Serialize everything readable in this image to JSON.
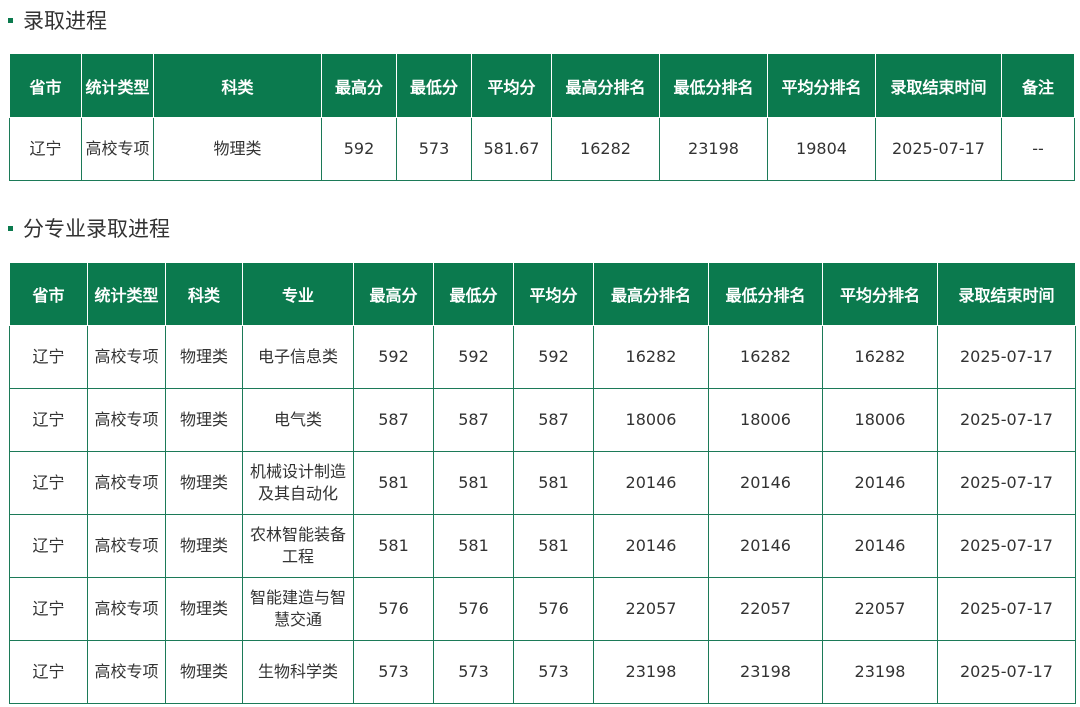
{
  "section1": {
    "title": "录取进程",
    "headers": [
      "省市",
      "统计类型",
      "科类",
      "最高分",
      "最低分",
      "平均分",
      "最高分排名",
      "最低分排名",
      "平均分排名",
      "录取结束时间",
      "备注"
    ],
    "rows": [
      [
        "辽宁",
        "高校专项",
        "物理类",
        "592",
        "573",
        "581.67",
        "16282",
        "23198",
        "19804",
        "2025-07-17",
        "--"
      ]
    ]
  },
  "section2": {
    "title": "分专业录取进程",
    "headers": [
      "省市",
      "统计类型",
      "科类",
      "专业",
      "最高分",
      "最低分",
      "平均分",
      "最高分排名",
      "最低分排名",
      "平均分排名",
      "录取结束时间"
    ],
    "rows": [
      [
        "辽宁",
        "高校专项",
        "物理类",
        "电子信息类",
        "592",
        "592",
        "592",
        "16282",
        "16282",
        "16282",
        "2025-07-17"
      ],
      [
        "辽宁",
        "高校专项",
        "物理类",
        "电气类",
        "587",
        "587",
        "587",
        "18006",
        "18006",
        "18006",
        "2025-07-17"
      ],
      [
        "辽宁",
        "高校专项",
        "物理类",
        "机械设计制造及其自动化",
        "581",
        "581",
        "581",
        "20146",
        "20146",
        "20146",
        "2025-07-17"
      ],
      [
        "辽宁",
        "高校专项",
        "物理类",
        "农林智能装备工程",
        "581",
        "581",
        "581",
        "20146",
        "20146",
        "20146",
        "2025-07-17"
      ],
      [
        "辽宁",
        "高校专项",
        "物理类",
        "智能建造与智慧交通",
        "576",
        "576",
        "576",
        "22057",
        "22057",
        "22057",
        "2025-07-17"
      ],
      [
        "辽宁",
        "高校专项",
        "物理类",
        "生物科学类",
        "573",
        "573",
        "573",
        "23198",
        "23198",
        "23198",
        "2025-07-17"
      ]
    ]
  }
}
